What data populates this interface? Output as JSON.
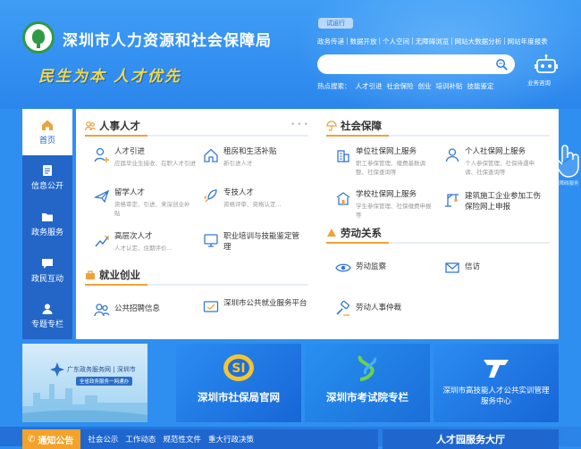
{
  "header": {
    "site_name": "深圳市人力资源和社会保障局",
    "slogan": "民生为本  人才优先",
    "trial_badge": "试运行",
    "top_links": [
      "政务传递",
      "数据开放",
      "个人空间",
      "无障碍浏览",
      "网站大数据分析",
      "网站年度报表"
    ],
    "search_placeholder": "",
    "hot_label": "热点搜索：",
    "hot_terms": [
      "人才引进",
      "社会保险",
      "创业",
      "培训补贴",
      "技能鉴定"
    ],
    "robot_label": "业务咨询",
    "hand_label": "无障碍服务"
  },
  "nav": [
    {
      "label": "首页",
      "icon": "home-icon",
      "active": true
    },
    {
      "label": "信息公开",
      "icon": "info-icon",
      "active": false
    },
    {
      "label": "政务服务",
      "icon": "folder-icon",
      "active": false
    },
    {
      "label": "政民互动",
      "icon": "chat-icon",
      "active": false
    },
    {
      "label": "专题专栏",
      "icon": "user-icon",
      "active": false
    }
  ],
  "sections": {
    "talent": {
      "title": "人事人才",
      "items": [
        {
          "title": "人才引进",
          "desc": "应届毕业生接收、在职人才引进",
          "icon": "person-plus-icon"
        },
        {
          "title": "租房和生活补贴",
          "desc": "新引进人才",
          "icon": "house-icon"
        },
        {
          "title": "留学人才",
          "desc": "资格审定、引进、来深创业补贴",
          "icon": "plane-icon"
        },
        {
          "title": "专技人才",
          "desc": "资格评审、资格认定...",
          "icon": "rocket-icon"
        },
        {
          "title": "高层次人才",
          "desc": "人才认定、住期评价...",
          "icon": "chart-icon"
        },
        {
          "title": "职业培训与技能鉴定管理",
          "desc": "",
          "icon": "training-icon"
        }
      ]
    },
    "business": {
      "title": "就业创业",
      "items": [
        {
          "title": "公共招聘信息",
          "desc": "",
          "icon": "people-icon"
        },
        {
          "title": "深圳市公共就业服务平台",
          "desc": "",
          "icon": "platform-icon"
        }
      ]
    },
    "social": {
      "title": "社会保障",
      "items": [
        {
          "title": "单位社保网上服务",
          "desc": "职工参保管理、缴费基数调整、社保查询等",
          "icon": "building-icon"
        },
        {
          "title": "个人社保网上服务",
          "desc": "个人参保管理、社保待遇申请、社保查询等",
          "icon": "person-icon"
        },
        {
          "title": "学校社保网上服务",
          "desc": "学生参保管理、社保缴费申报等",
          "icon": "school-icon"
        },
        {
          "title": "建筑施工企业参加工伤保险网上申报",
          "desc": "",
          "icon": "crane-icon"
        }
      ]
    },
    "labor": {
      "title": "劳动关系",
      "items": [
        {
          "title": "劳动监察",
          "desc": "",
          "icon": "eye-icon"
        },
        {
          "title": "信访",
          "desc": "",
          "icon": "mail-icon"
        },
        {
          "title": "劳动人事仲裁",
          "desc": "",
          "icon": "gavel-icon"
        }
      ]
    }
  },
  "banners": [
    {
      "name": "广东政务服务网",
      "sub": "深圳市",
      "note": "全省政务服务一网通办"
    },
    {
      "name": "深圳市社保局官网"
    },
    {
      "name": "深圳市考试院专栏"
    },
    {
      "name": "深圳市高技能人才公共实训管理服务中心"
    }
  ],
  "bottom": {
    "notice_title": "通知公告",
    "notice_tabs": [
      "社会公示",
      "工作动态",
      "规范性文件",
      "重大行政决策"
    ],
    "talent_title": "人才园服务大厅"
  },
  "colors": {
    "primary": "#2366c7",
    "accent": "#f0a13a",
    "header": "#3f9df5"
  }
}
